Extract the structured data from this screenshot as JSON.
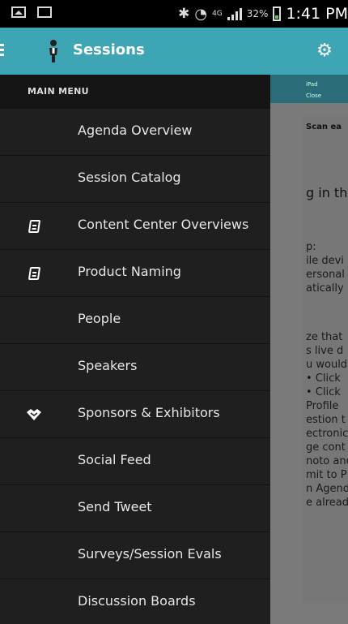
{
  "status_bar": {
    "battery": "32%",
    "time": "1:41 PM",
    "network": "4G"
  },
  "app_bar": {
    "title": "Sessions"
  },
  "drawer": {
    "section_header": "MAIN MENU",
    "items": [
      {
        "label": "Agenda Overview",
        "icon": ""
      },
      {
        "label": "Session Catalog",
        "icon": ""
      },
      {
        "label": "Content Center Overviews",
        "icon": "book-icon"
      },
      {
        "label": "Product Naming",
        "icon": "book-icon"
      },
      {
        "label": "People",
        "icon": ""
      },
      {
        "label": "Speakers",
        "icon": ""
      },
      {
        "label": "Sponsors & Exhibitors",
        "icon": "handshake-icon"
      },
      {
        "label": "Social Feed",
        "icon": ""
      },
      {
        "label": "Send Tweet",
        "icon": ""
      },
      {
        "label": "Surveys/Session Evals",
        "icon": ""
      },
      {
        "label": "Discussion Boards",
        "icon": ""
      }
    ]
  },
  "background_content": {
    "top_labels": [
      "iPad",
      "Close"
    ],
    "scan_text": "Scan ea",
    "heading": "g in the",
    "lines": [
      "p:",
      "ile devi",
      "ersonal",
      "atically",
      "ze that",
      "s live d",
      "u would",
      "• Click",
      "• Click",
      "Profile",
      "estion t",
      "ectronic",
      "ge cont",
      "noto and",
      "mit to P",
      "n Agend",
      "e alread"
    ]
  },
  "colors": {
    "accent": "#3da5b4",
    "drawer_bg": "#1f1f1f",
    "header_bg": "#151515"
  }
}
